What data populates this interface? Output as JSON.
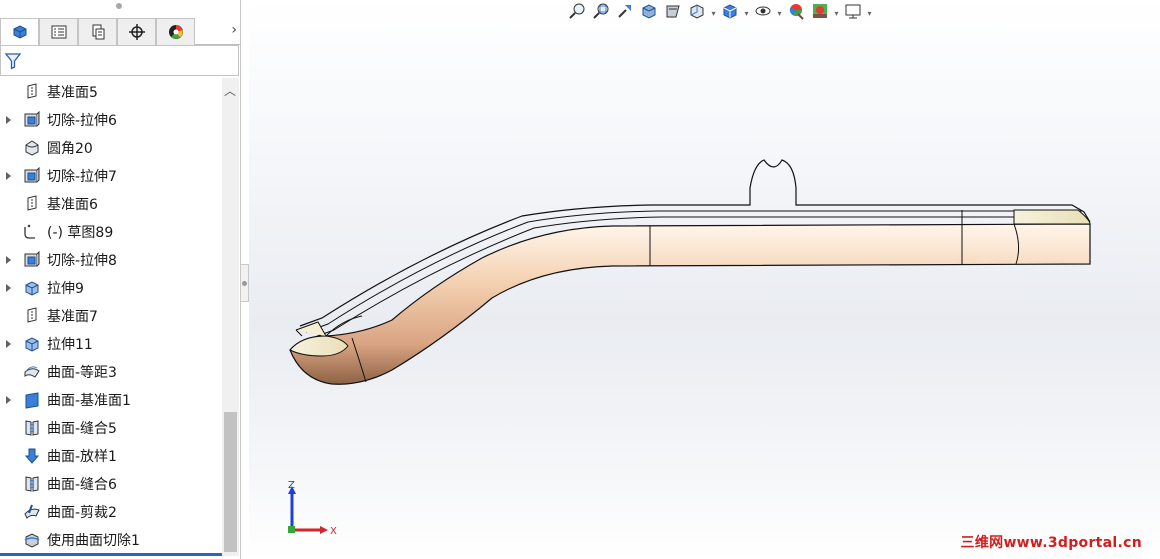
{
  "tabs": [
    {
      "name": "feature-manager",
      "icon": "feature-manager-icon"
    },
    {
      "name": "property-manager",
      "icon": "property-manager-icon"
    },
    {
      "name": "configuration-manager",
      "icon": "configuration-manager-icon"
    },
    {
      "name": "dimxpert-manager",
      "icon": "dimxpert-icon"
    },
    {
      "name": "display-manager",
      "icon": "display-manager-icon"
    }
  ],
  "tree": [
    {
      "label": "基准面5",
      "icon": "plane-icon",
      "expandable": false
    },
    {
      "label": "切除-拉伸6",
      "icon": "cut-extrude-icon",
      "expandable": true
    },
    {
      "label": "圆角20",
      "icon": "fillet-icon",
      "expandable": false
    },
    {
      "label": "切除-拉伸7",
      "icon": "cut-extrude-icon",
      "expandable": true
    },
    {
      "label": "基准面6",
      "icon": "plane-icon",
      "expandable": false
    },
    {
      "label": "(-) 草图89",
      "icon": "sketch-icon",
      "expandable": false
    },
    {
      "label": "切除-拉伸8",
      "icon": "cut-extrude-icon",
      "expandable": true
    },
    {
      "label": "拉伸9",
      "icon": "boss-extrude-icon",
      "expandable": true
    },
    {
      "label": "基准面7",
      "icon": "plane-icon",
      "expandable": false
    },
    {
      "label": "拉伸11",
      "icon": "boss-extrude-icon",
      "expandable": true
    },
    {
      "label": "曲面-等距3",
      "icon": "surface-offset-icon",
      "expandable": false
    },
    {
      "label": "曲面-基准面1",
      "icon": "planar-surface-icon",
      "expandable": true
    },
    {
      "label": "曲面-缝合5",
      "icon": "surface-knit-icon",
      "expandable": false
    },
    {
      "label": "曲面-放样1",
      "icon": "surface-loft-icon",
      "expandable": false
    },
    {
      "label": "曲面-缝合6",
      "icon": "surface-knit-icon",
      "expandable": false
    },
    {
      "label": "曲面-剪裁2",
      "icon": "surface-trim-icon",
      "expandable": false
    },
    {
      "label": "使用曲面切除1",
      "icon": "surface-cut-icon",
      "expandable": false
    }
  ],
  "hud": [
    {
      "name": "zoom-to-fit",
      "icon": "zoom-to-fit-icon"
    },
    {
      "name": "zoom-to-area",
      "icon": "zoom-to-area-icon"
    },
    {
      "name": "previous-view",
      "icon": "previous-view-icon"
    },
    {
      "name": "section-view",
      "icon": "section-view-icon"
    },
    {
      "name": "dynamic-annotation",
      "icon": "dynamic-annotation-icon"
    },
    {
      "name": "view-orientation",
      "icon": "view-orientation-icon",
      "dropdown": true
    },
    {
      "name": "display-style",
      "icon": "display-style-icon",
      "dropdown": true
    },
    {
      "name": "hide-show-items",
      "icon": "hide-show-icon",
      "dropdown": true
    },
    {
      "name": "edit-appearance",
      "icon": "edit-appearance-icon"
    },
    {
      "name": "apply-scene",
      "icon": "apply-scene-icon",
      "dropdown": true
    },
    {
      "name": "view-settings",
      "icon": "view-settings-icon",
      "dropdown": true
    }
  ],
  "triad": {
    "z": "Z",
    "x": "X"
  },
  "watermark": "三维网www.3dportal.cn",
  "colors": {
    "accent": "#2a63c9",
    "part": "#f2c9a8",
    "watermark": "#d11e1e"
  }
}
